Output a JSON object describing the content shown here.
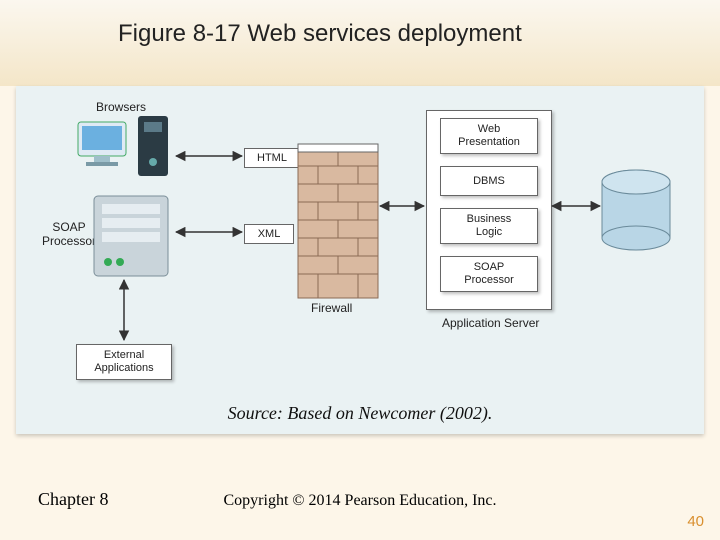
{
  "title": "Figure 8-17  Web services deployment",
  "source": "Source: Based on Newcomer (2002).",
  "chapter": "Chapter 8",
  "copyright": "Copyright © 2014 Pearson Education, Inc.",
  "page_number": "40",
  "labels": {
    "browsers": "Browsers",
    "soap_proc_client": "SOAP\nProcessor",
    "external_apps": "External\nApplications",
    "html": "HTML",
    "xml": "XML",
    "firewall": "Firewall",
    "app_server_caption": "Application Server",
    "web_presentation": "Web\nPresentation",
    "dbms": "DBMS",
    "business_logic": "Business\nLogic",
    "soap_proc_server": "SOAP\nProcessor",
    "db": "DB"
  },
  "diagram": {
    "type": "network-architecture",
    "nodes": [
      {
        "id": "browsers",
        "kind": "client/monitor+tower"
      },
      {
        "id": "soap_processor_client",
        "kind": "server"
      },
      {
        "id": "external_applications",
        "kind": "box"
      },
      {
        "id": "firewall",
        "kind": "firewall-brick"
      },
      {
        "id": "application_server",
        "kind": "container",
        "children": [
          "web_presentation",
          "dbms",
          "business_logic",
          "soap_processor_server"
        ]
      },
      {
        "id": "db",
        "kind": "cylinder"
      }
    ],
    "edges": [
      {
        "from": "browsers",
        "to": "firewall",
        "label": "HTML",
        "bidir": true
      },
      {
        "from": "soap_processor_client",
        "to": "firewall",
        "label": "XML",
        "bidir": true
      },
      {
        "from": "soap_processor_client",
        "to": "external_applications",
        "bidir": true
      },
      {
        "from": "firewall",
        "to": "application_server",
        "bidir": true
      },
      {
        "from": "application_server",
        "to": "db",
        "bidir": true
      }
    ]
  }
}
